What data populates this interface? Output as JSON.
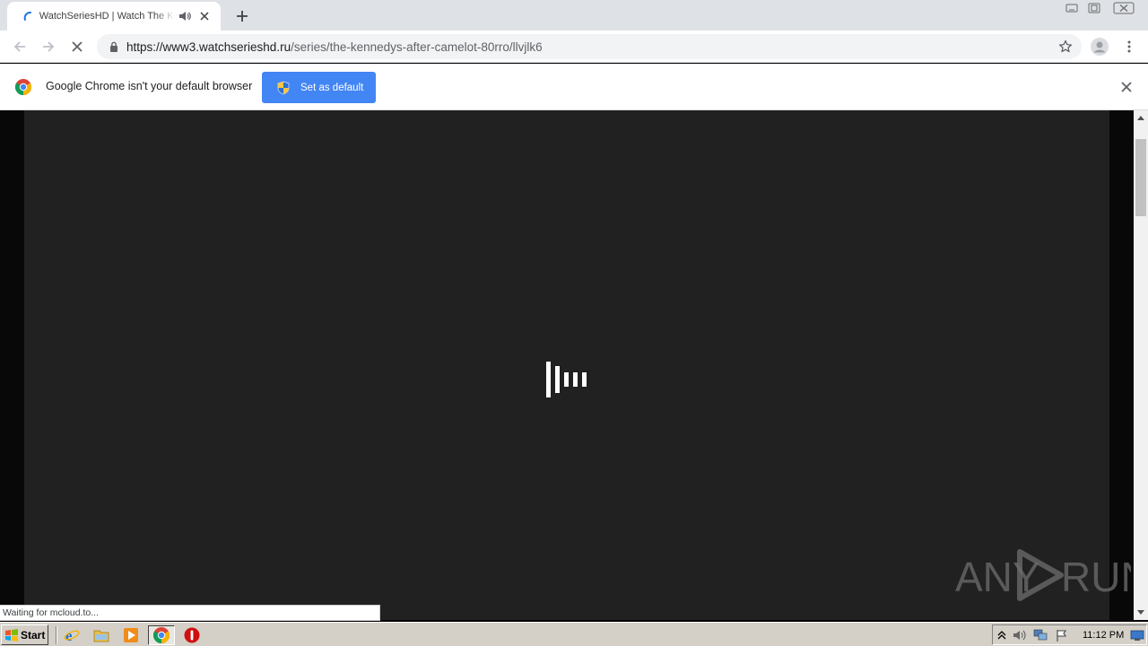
{
  "browser": {
    "tab": {
      "title": "WatchSeriesHD | Watch The Kennedys After Camelot",
      "favicon": "loading-spinner-icon",
      "audio_icon": "speaker-icon",
      "close_icon": "close-icon"
    },
    "new_tab_icon": "plus-icon",
    "window_controls": [
      "minimize-icon",
      "restore-icon",
      "close-icon"
    ],
    "toolbar": {
      "back_icon": "arrow-left-icon",
      "forward_icon": "arrow-right-icon",
      "stop_icon": "close-icon",
      "url_host": "https://www3.watchserieshd.ru",
      "url_path": "/series/the-kennedys-after-camelot-80rro/llvjlk6",
      "bookmark_icon": "star-icon",
      "profile_icon": "avatar-icon",
      "menu_icon": "kebab-icon"
    },
    "infobar": {
      "message": "Google Chrome isn't your default browser",
      "button_label": "Set as default",
      "accent": "#4285f4"
    },
    "status_text": "Waiting for mcloud.to..."
  },
  "page": {
    "player_background": "#212121",
    "loader_icon": "loading-bars-icon",
    "watermark": "ANY RUN"
  },
  "taskbar": {
    "start_label": "Start",
    "apps": [
      "internet-explorer-icon",
      "folder-icon",
      "media-player-icon",
      "chrome-icon",
      "opera-icon"
    ],
    "clock": "11:12 PM"
  }
}
